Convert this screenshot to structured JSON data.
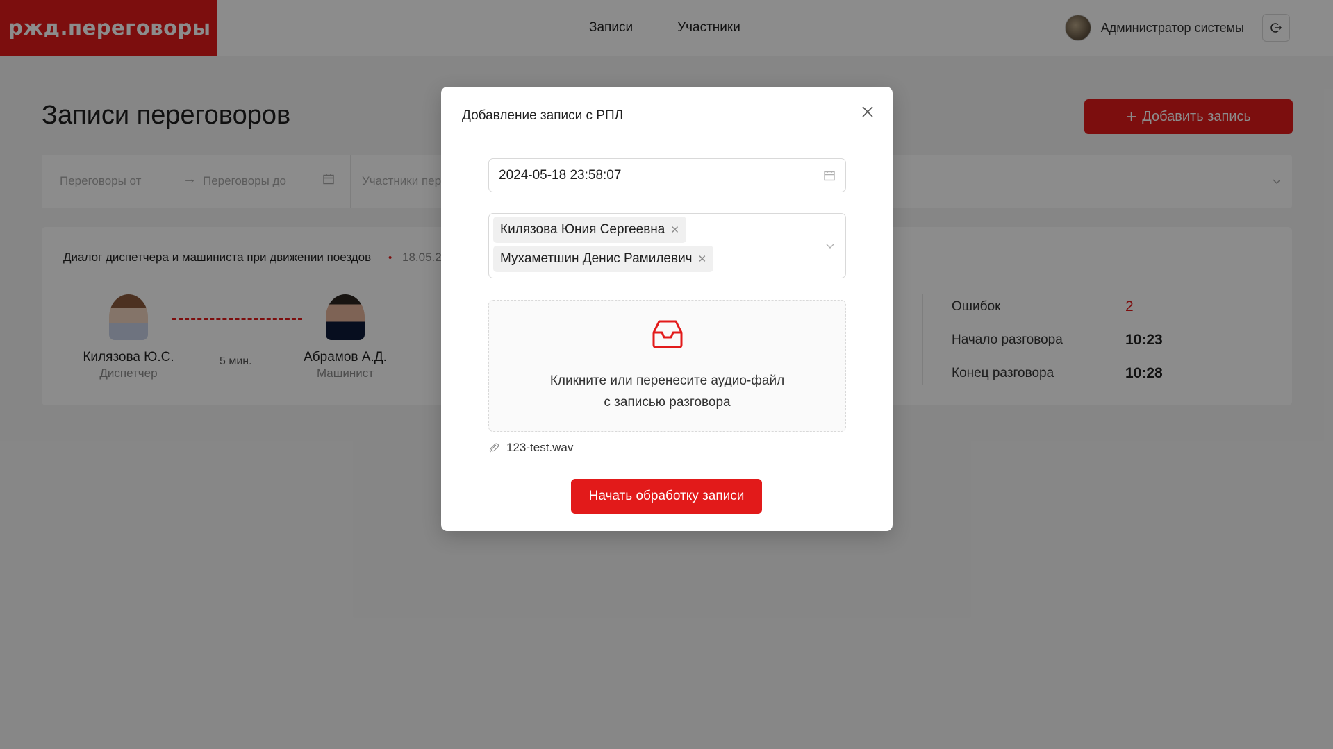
{
  "header": {
    "logo": "ржд.переговоры",
    "nav": [
      "Записи",
      "Участники"
    ],
    "user_name": "Администратор системы",
    "logout_icon": "logout-icon"
  },
  "page": {
    "title": "Записи переговоров",
    "add_button": "Добавить запись"
  },
  "filters": {
    "from_placeholder": "Переговоры от",
    "to_placeholder": "Переговоры до",
    "participants_placeholder": "Участники пер"
  },
  "record": {
    "title": "Диалог диспетчера и машиниста при движении поездов",
    "date": "18.05.2",
    "duration": "5 мин.",
    "participants": [
      {
        "name": "Килязова Ю.С.",
        "role": "Диспетчер"
      },
      {
        "name": "Абрамов А.Д.",
        "role": "Машинист"
      }
    ],
    "stats": [
      {
        "label": "Ошибок",
        "value": "2"
      },
      {
        "label": "Начало разговора",
        "value": "10:23"
      },
      {
        "label": "Конец разговора",
        "value": "10:28"
      }
    ]
  },
  "modal": {
    "title": "Добавление записи с РПЛ",
    "datetime_value": "2024-05-18 23:58:07",
    "selected_participants": [
      "Килязова Юния Сергеевна",
      "Мухаметшин Денис Рамилевич"
    ],
    "dropzone_line1": "Кликните или перенесите аудио-файл",
    "dropzone_line2": "с записью разговора",
    "file_name": "123-test.wav",
    "submit_label": "Начать обработку записи"
  },
  "colors": {
    "brand": "#e21a1a",
    "overlay": "rgba(0,0,0,0.45)"
  }
}
